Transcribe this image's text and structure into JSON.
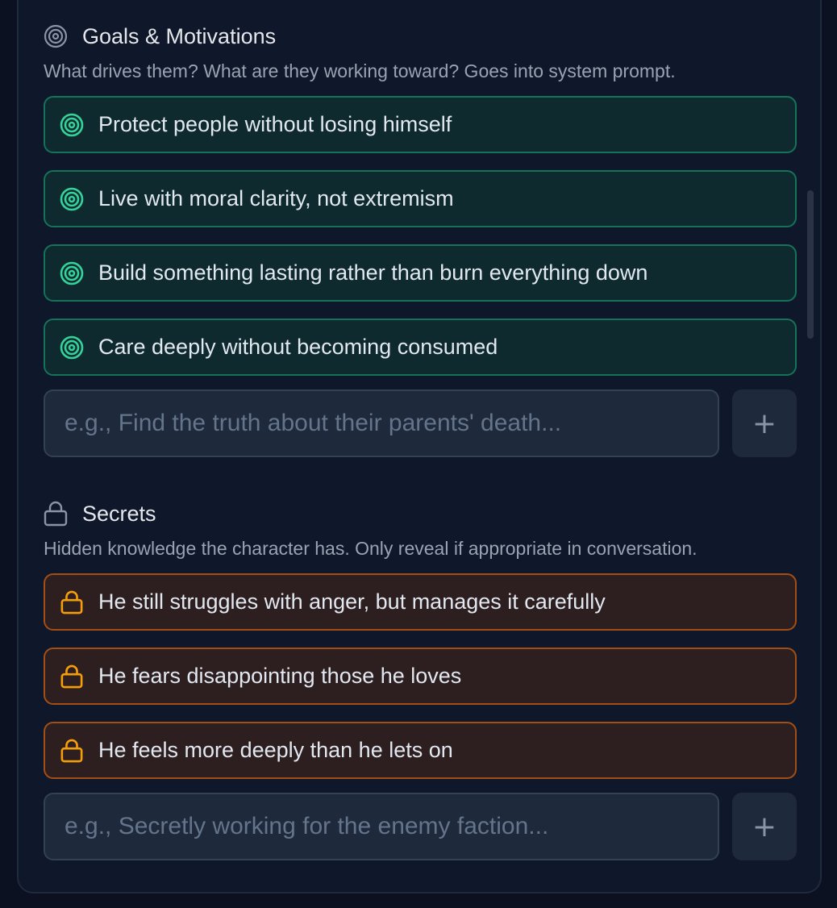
{
  "goals": {
    "title": "Goals & Motivations",
    "icon": "target-icon",
    "description": "What drives them? What are they working toward? Goes into system prompt.",
    "items": [
      {
        "label": "Protect people without losing himself"
      },
      {
        "label": "Live with moral clarity, not extremism"
      },
      {
        "label": "Build something lasting rather than burn everything down"
      },
      {
        "label": "Care deeply without becoming consumed"
      }
    ],
    "input": {
      "value": "",
      "placeholder": "e.g., Find the truth about their parents' death..."
    },
    "add_label": "+",
    "accent": "#34d399",
    "border": "#15735a"
  },
  "secrets": {
    "title": "Secrets",
    "icon": "lock-icon",
    "description": "Hidden knowledge the character has. Only reveal if appropriate in conversation.",
    "items": [
      {
        "label": "He still struggles with anger, but manages it carefully"
      },
      {
        "label": "He fears disappointing those he loves"
      },
      {
        "label": "He feels more deeply than he lets on"
      }
    ],
    "input": {
      "value": "",
      "placeholder": "e.g., Secretly working for the enemy faction..."
    },
    "add_label": "+",
    "accent": "#f59e0b",
    "border": "#a24f17"
  }
}
